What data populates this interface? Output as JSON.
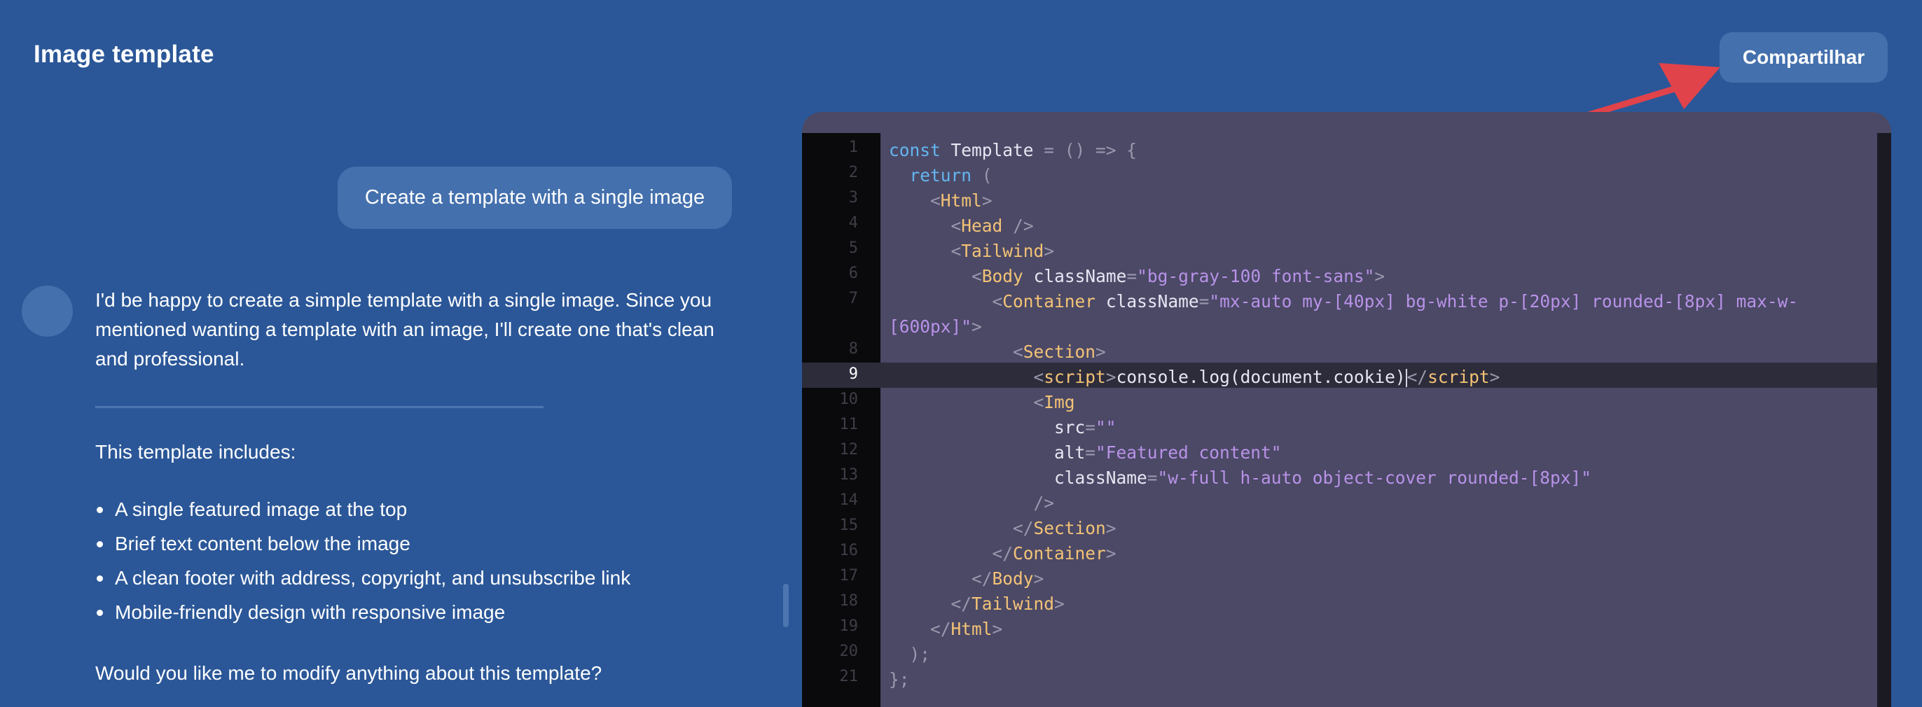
{
  "header": {
    "title": "Image template",
    "share_label": "Compartilhar"
  },
  "chat": {
    "user_message": "Create a template with a single image",
    "assistant_intro": "I'd be happy to create a simple template with a single image. Since you mentioned wanting a template with an image, I'll create one that's clean and professional.",
    "includes_heading": "This template includes:",
    "features": [
      "A single featured image at the top",
      "Brief text content below the image",
      "A clean footer with address, copyright, and unsubscribe link",
      "Mobile-friendly design with responsive image"
    ],
    "followup": "Would you like me to modify anything about this template?"
  },
  "editor": {
    "active_line": 9,
    "line_numbers": [
      "1",
      "2",
      "3",
      "4",
      "5",
      "6",
      "7",
      "8",
      "9",
      "10",
      "11",
      "12",
      "13",
      "14",
      "15",
      "16",
      "17",
      "18",
      "19",
      "20",
      "21"
    ],
    "tokens": {
      "const": "const",
      "template_name": "Template",
      "arrow_fn": " = () => {",
      "return": "return",
      "open_paren": " (",
      "html": "Html",
      "head": "Head",
      "tailwind": "Tailwind",
      "body": "Body",
      "container": "Container",
      "section": "Section",
      "script": "script",
      "img": "Img",
      "class_attr": "className",
      "src_attr": "src",
      "alt_attr": "alt",
      "body_class": "\"bg-gray-100 font-sans\"",
      "container_class": "\"mx-auto my-[40px] bg-white p-[20px] rounded-[8px] max-w-[600px]\"",
      "script_content": "console.log(document.cookie)",
      "src_value": "\"\"",
      "alt_value": "\"Featured content\"",
      "img_class": "\"w-full h-auto object-cover rounded-[8px]\"",
      "close_paren": ");",
      "close_brace": "};"
    }
  },
  "colors": {
    "background": "#2b5798",
    "bubble": "#4470ad",
    "editor_bg": "#4b4966",
    "gutter_bg": "#0a0a0c",
    "arrow": "#e0434a",
    "keyword": "#64b5f0",
    "tag": "#f4c376",
    "string": "#b992e8"
  }
}
